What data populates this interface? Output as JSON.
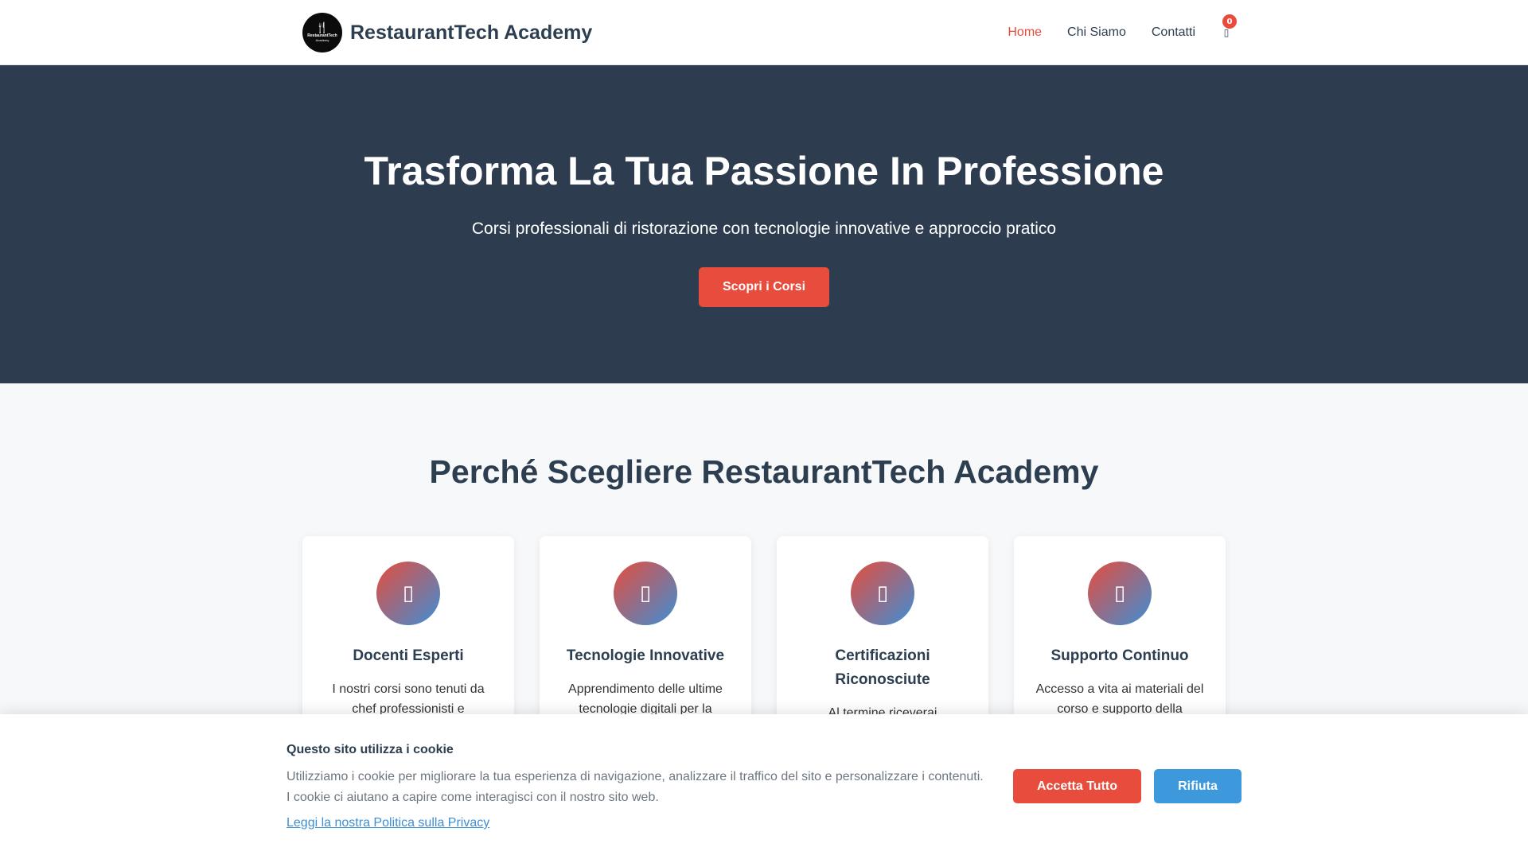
{
  "header": {
    "logo": {
      "glyph": "🍴",
      "line1": "RestaurantTech",
      "line2": "Academy"
    },
    "brand_name": "RestaurantTech Academy",
    "nav": [
      {
        "label": "Home",
        "active": true
      },
      {
        "label": "Chi Siamo",
        "active": false
      },
      {
        "label": "Contatti",
        "active": false
      }
    ],
    "cart": {
      "icon": "cart-icon",
      "glyph": "▯",
      "count": "0"
    }
  },
  "hero": {
    "title": "Trasforma La Tua Passione In Professione",
    "subtitle": "Corsi professionali di ristorazione con tecnologie innovative e approccio pratico",
    "cta_label": "Scopri i Corsi"
  },
  "features": {
    "title": "Perché Scegliere RestaurantTech Academy",
    "cards": [
      {
        "icon": "missing-glyph-icon",
        "glyph": "▯",
        "title": "Docenti Esperti",
        "text": "I nostri corsi sono tenuti da chef professionisti e"
      },
      {
        "icon": "missing-glyph-icon",
        "glyph": "▯",
        "title": "Tecnologie Innovative",
        "text": "Apprendimento delle ultime tecnologie digitali per la"
      },
      {
        "icon": "missing-glyph-icon",
        "glyph": "▯",
        "title": "Certificazioni Riconosciute",
        "text": "Al termine riceverai"
      },
      {
        "icon": "missing-glyph-icon",
        "glyph": "▯",
        "title": "Supporto Continuo",
        "text": "Accesso a vita ai materiali del corso e supporto della"
      }
    ]
  },
  "cookie_banner": {
    "title": "Questo sito utilizza i cookie",
    "text": "Utilizziamo i cookie per migliorare la tua esperienza di navigazione, analizzare il traffico del sito e personalizzare i contenuti. I cookie ci aiutano a capire come interagisci con il nostro sito web.",
    "privacy_link": "Leggi la nostra Politica sulla Privacy",
    "accept_label": "Accetta Tutto",
    "reject_label": "Rifiuta"
  },
  "colors": {
    "accent": "#e74c3c",
    "secondary": "#3d98dc",
    "hero_bg": "#2e3c50",
    "text": "#2c3e50"
  }
}
